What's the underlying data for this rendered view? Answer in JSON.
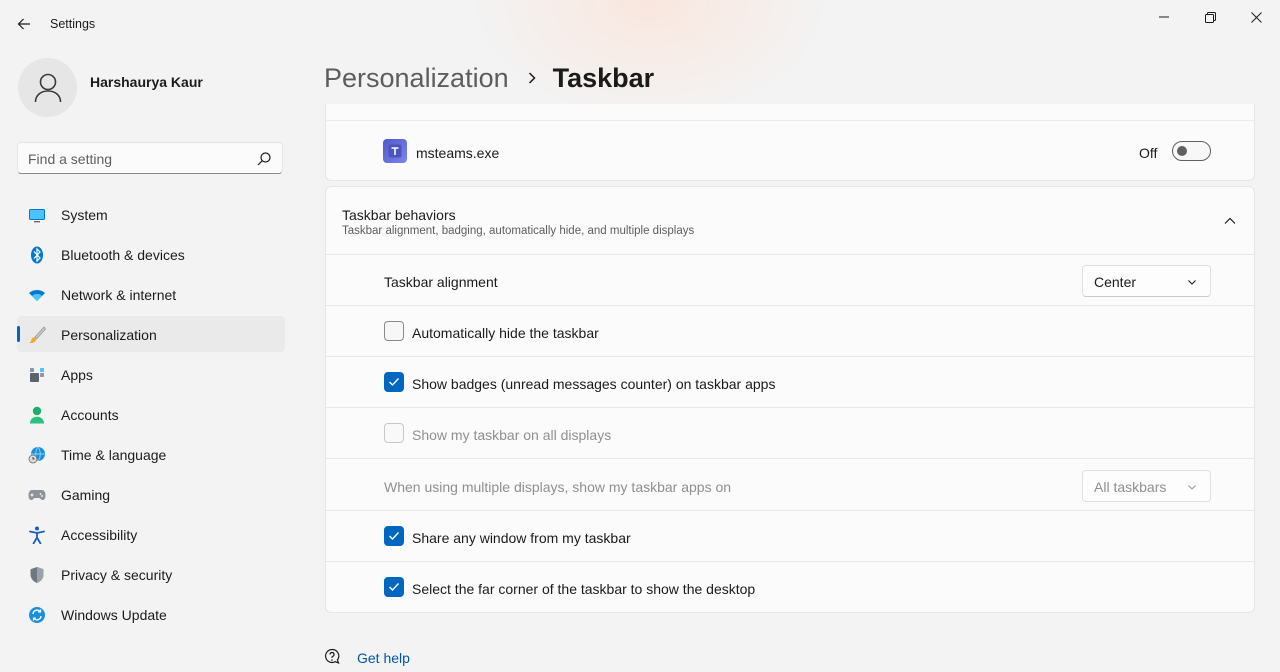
{
  "window": {
    "title": "Settings",
    "controls": [
      "minimize",
      "maximize",
      "close"
    ]
  },
  "profile": {
    "name": "Harshaurya Kaur"
  },
  "search": {
    "placeholder": "Find a setting",
    "value": ""
  },
  "sidebar": {
    "items": [
      {
        "label": "System",
        "icon": "monitor-icon"
      },
      {
        "label": "Bluetooth & devices",
        "icon": "bluetooth-icon"
      },
      {
        "label": "Network & internet",
        "icon": "wifi-icon"
      },
      {
        "label": "Personalization",
        "icon": "paintbrush-icon",
        "active": true
      },
      {
        "label": "Apps",
        "icon": "apps-icon"
      },
      {
        "label": "Accounts",
        "icon": "person-icon"
      },
      {
        "label": "Time & language",
        "icon": "globe-clock-icon"
      },
      {
        "label": "Gaming",
        "icon": "gamepad-icon"
      },
      {
        "label": "Accessibility",
        "icon": "accessibility-icon"
      },
      {
        "label": "Privacy & security",
        "icon": "shield-icon"
      },
      {
        "label": "Windows Update",
        "icon": "update-icon"
      }
    ]
  },
  "breadcrumb": {
    "parent": "Personalization",
    "current": "Taskbar"
  },
  "overflow_app": {
    "name": "msteams.exe",
    "toggle_label": "Off",
    "toggle_on": false
  },
  "behaviors": {
    "title": "Taskbar behaviors",
    "subtitle": "Taskbar alignment, badging, automatically hide, and multiple displays",
    "alignment": {
      "label": "Taskbar alignment",
      "value": "Center"
    },
    "auto_hide": {
      "label": "Automatically hide the taskbar",
      "checked": false
    },
    "badges": {
      "label": "Show badges (unread messages counter) on taskbar apps",
      "checked": true
    },
    "all_displays": {
      "label": "Show my taskbar on all displays",
      "checked": false,
      "disabled": true
    },
    "multi_display": {
      "label": "When using multiple displays, show my taskbar apps on",
      "value": "All taskbars",
      "disabled": true
    },
    "share_window": {
      "label": "Share any window from my taskbar",
      "checked": true
    },
    "far_corner": {
      "label": "Select the far corner of the taskbar to show the desktop",
      "checked": true
    }
  },
  "help": {
    "label": "Get help"
  },
  "colors": {
    "accent": "#0067c0",
    "background": "#f3f3f3",
    "card": "#fbfbfb"
  }
}
